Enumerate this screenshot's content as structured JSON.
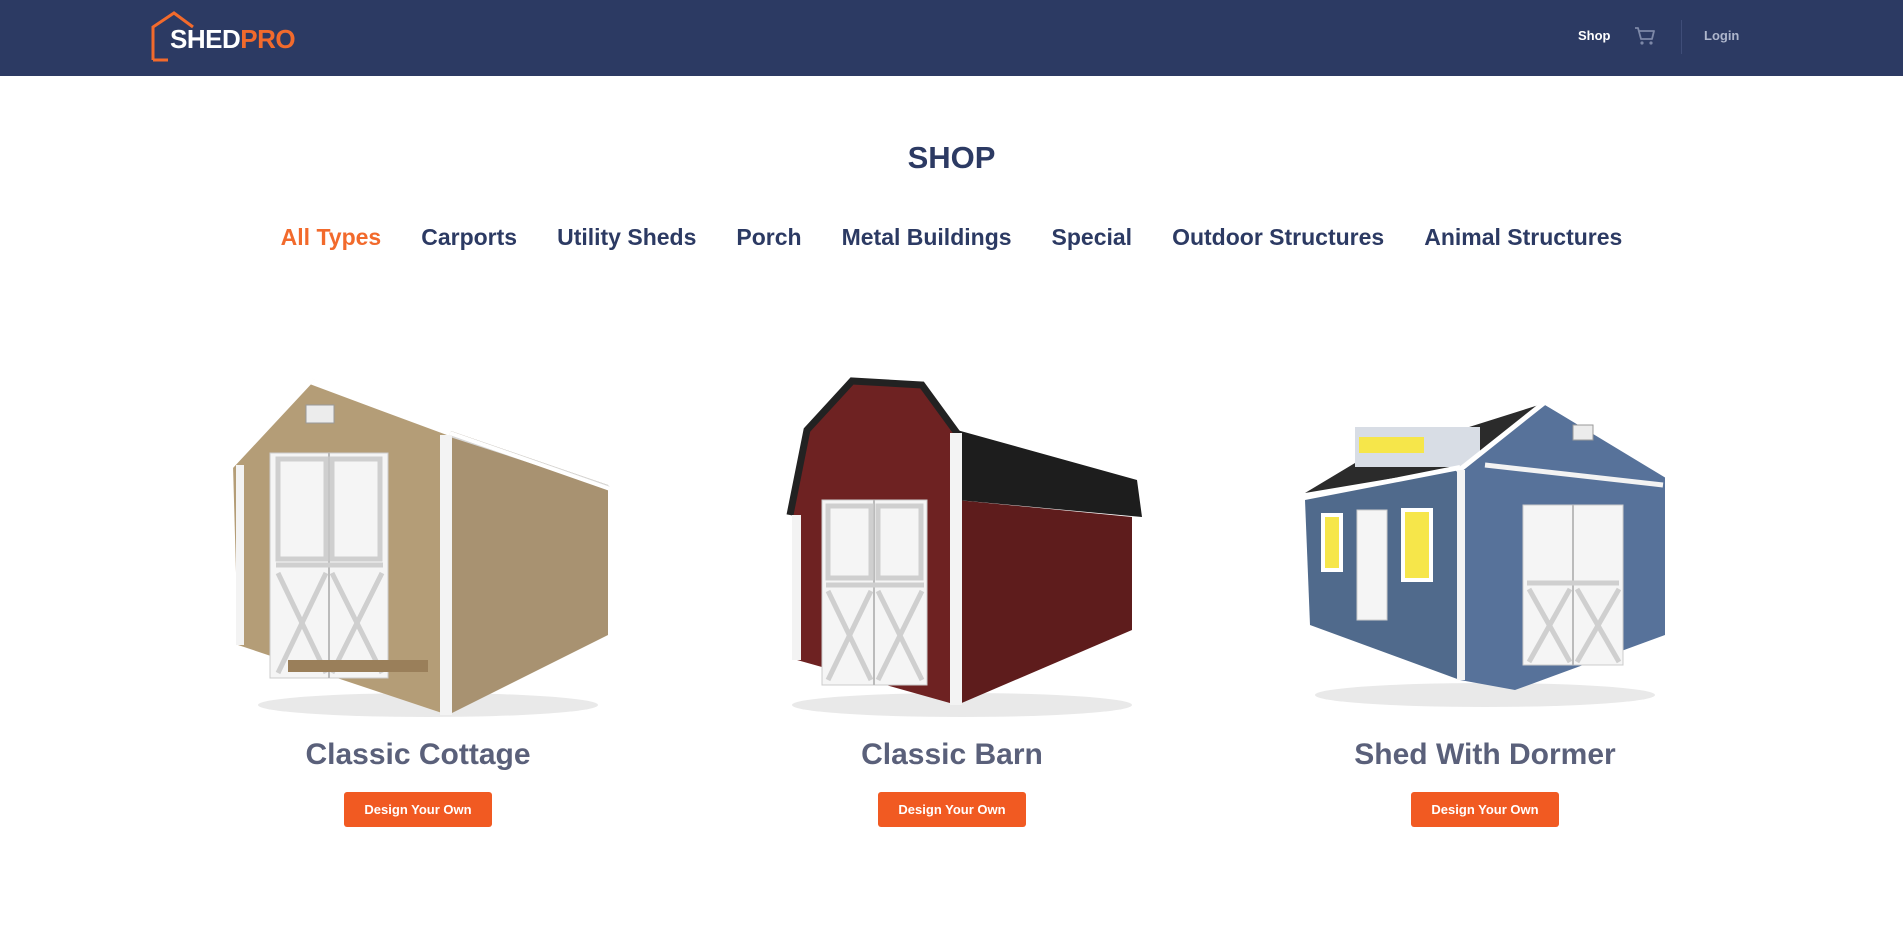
{
  "header": {
    "logo": {
      "word1": "SHED",
      "word2": "PRO"
    },
    "nav": {
      "shop": "Shop",
      "cart_icon": "cart-icon",
      "login": "Login"
    }
  },
  "page": {
    "title": "SHOP"
  },
  "tabs": [
    {
      "label": "All Types",
      "active": true
    },
    {
      "label": "Carports"
    },
    {
      "label": "Utility Sheds"
    },
    {
      "label": "Porch"
    },
    {
      "label": "Metal Buildings"
    },
    {
      "label": "Special"
    },
    {
      "label": "Outdoor Structures"
    },
    {
      "label": "Animal Structures"
    }
  ],
  "products": [
    {
      "name": "Classic Cottage",
      "button": "Design Your Own",
      "wall_color": "#b49d77"
    },
    {
      "name": "Classic Barn",
      "button": "Design Your Own",
      "wall_color": "#6e2222"
    },
    {
      "name": "Shed With Dormer",
      "button": "Design Your Own",
      "wall_color": "#506a8c"
    }
  ],
  "colors": {
    "header_bg": "#2c3a63",
    "accent": "#f26a2c",
    "button_bg": "#f15a22",
    "title_text": "#2c3a63",
    "product_title": "#5a607a"
  }
}
